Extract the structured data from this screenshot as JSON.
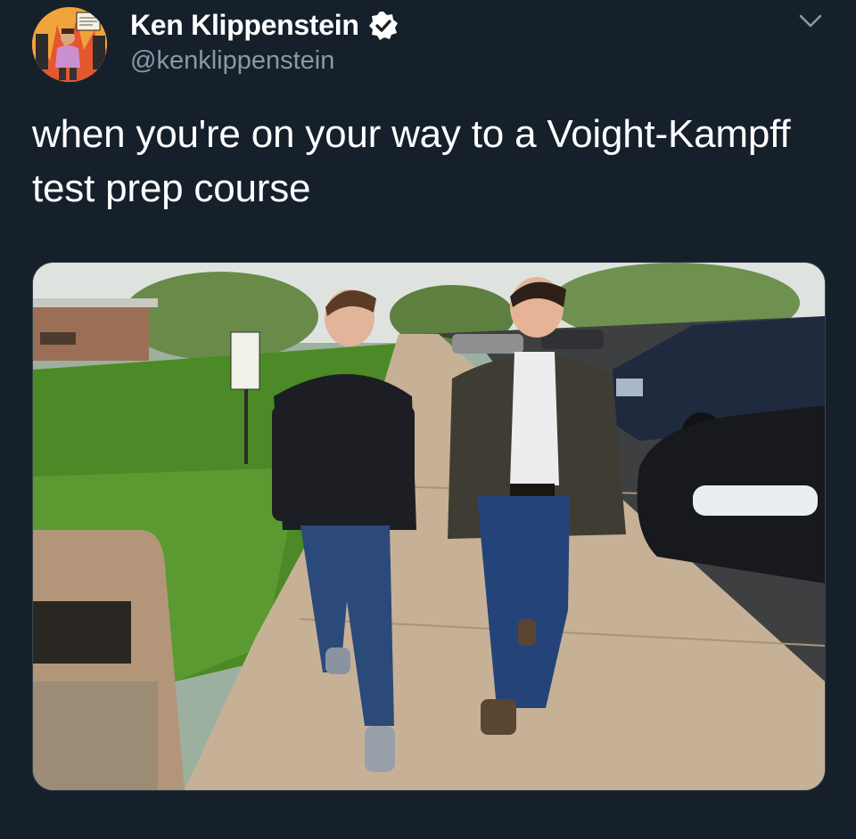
{
  "tweet": {
    "author": {
      "display_name": "Ken Klippenstein",
      "handle": "@kenklippenstein",
      "verified": true,
      "avatar_icon": "comic-avatar-icon",
      "verified_icon": "verified-badge-icon"
    },
    "more_icon": "chevron-down-icon",
    "text": "when you're on your way to a Voight-Kampff test prep course",
    "media": {
      "type": "photo",
      "alt_icon": "photo-two-men-walking-on-sidewalk"
    }
  },
  "colors": {
    "background": "#15202b",
    "text_primary": "#ffffff",
    "text_secondary": "#8899a6",
    "border": "#38444d"
  }
}
